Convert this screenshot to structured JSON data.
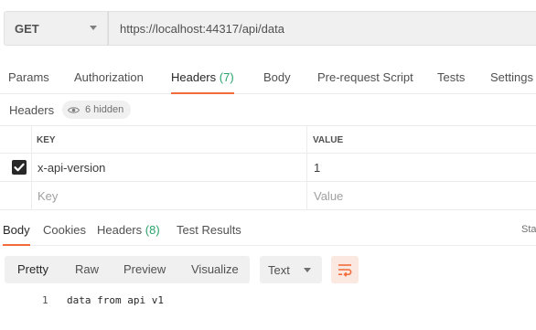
{
  "request": {
    "method": "GET",
    "url": "https://localhost:44317/api/data"
  },
  "request_tabs": [
    {
      "label": "Params"
    },
    {
      "label": "Authorization"
    },
    {
      "label": "Headers",
      "count": "(7)"
    },
    {
      "label": "Body"
    },
    {
      "label": "Pre-request Script"
    },
    {
      "label": "Tests"
    },
    {
      "label": "Settings"
    }
  ],
  "headers_section": {
    "title": "Headers",
    "hidden_label": "6 hidden"
  },
  "headers_table": {
    "columns": [
      "KEY",
      "VALUE"
    ],
    "rows": [
      {
        "checked": true,
        "key": "x-api-version",
        "value": "1"
      }
    ],
    "new_row": {
      "key_placeholder": "Key",
      "value_placeholder": "Value"
    }
  },
  "response_tabs": [
    {
      "label": "Body"
    },
    {
      "label": "Cookies"
    },
    {
      "label": "Headers",
      "count": "(8)"
    },
    {
      "label": "Test Results"
    }
  ],
  "response_status_cut": "Sta",
  "response_toolbar": {
    "views": [
      "Pretty",
      "Raw",
      "Preview",
      "Visualize"
    ],
    "format": "Text"
  },
  "response_body": [
    {
      "line": "1",
      "text": "data from api v1"
    }
  ],
  "colors": {
    "accent": "#f26b3a",
    "count_green": "#2aa36a"
  }
}
